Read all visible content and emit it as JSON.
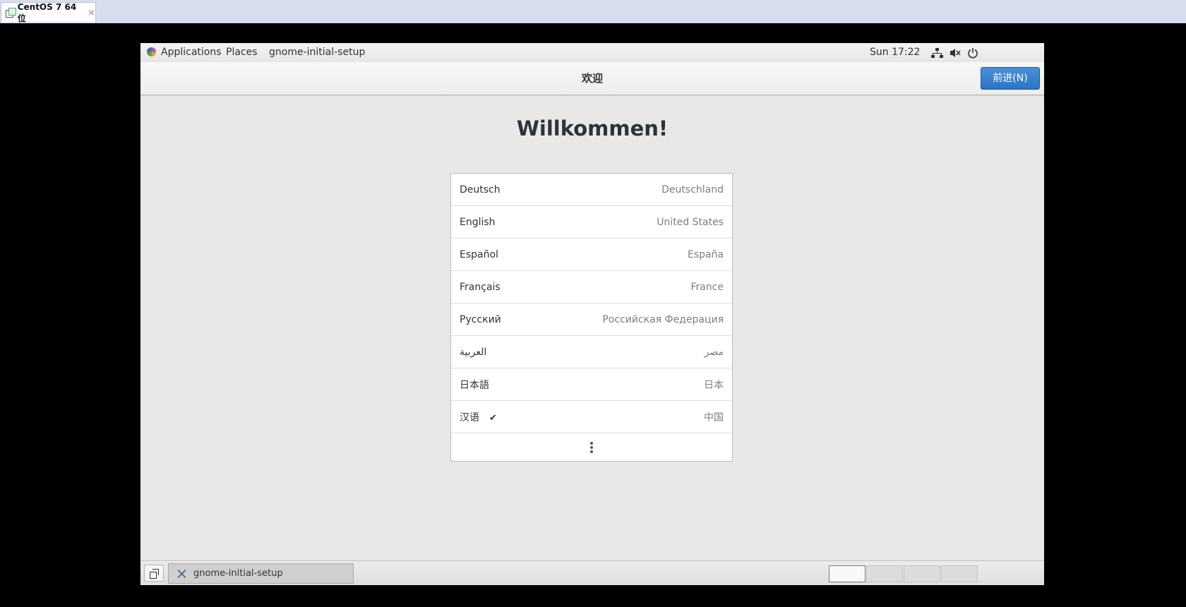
{
  "host": {
    "tab_title": "CentOS 7 64 位",
    "close_glyph": "×"
  },
  "topbar": {
    "applications": "Applications",
    "places": "Places",
    "app_name": "gnome-initial-setup",
    "clock": "Sun 17:22",
    "icons": [
      "network-icon",
      "volume-muted-icon",
      "power-icon"
    ]
  },
  "header": {
    "title": "欢迎",
    "next_button": "前进(N)"
  },
  "welcome_heading": "Willkommen!",
  "languages": [
    {
      "name": "Deutsch",
      "region": "Deutschland",
      "selected": false
    },
    {
      "name": "English",
      "region": "United States",
      "selected": false
    },
    {
      "name": "Español",
      "region": "España",
      "selected": false
    },
    {
      "name": "Français",
      "region": "France",
      "selected": false
    },
    {
      "name": "Русский",
      "region": "Российская Федерация",
      "selected": false
    },
    {
      "name": "العربية",
      "region": "مصر",
      "selected": false
    },
    {
      "name": "日本語",
      "region": "日本",
      "selected": false
    },
    {
      "name": "汉语",
      "region": "中国",
      "selected": true
    }
  ],
  "check_glyph": "✔",
  "taskbar": {
    "task_label": "gnome-initial-setup",
    "workspaces": 4,
    "active_workspace": 1
  },
  "colors": {
    "accent": "#2a76c6",
    "background": "#e8e8e7"
  }
}
